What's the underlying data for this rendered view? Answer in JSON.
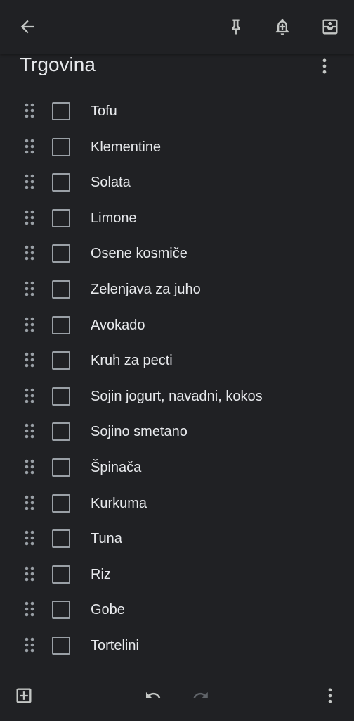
{
  "colors": {
    "background": "#202124",
    "text": "#e8eaed",
    "icon": "#c4c7c5",
    "icon_disabled": "#5f6368",
    "checkbox_border": "#9aa0a6"
  },
  "toolbar": {
    "back_icon": "arrow-back-icon",
    "pin_icon": "pin-icon",
    "reminder_icon": "add-alert-icon",
    "archive_icon": "archive-icon"
  },
  "note": {
    "title": "Trgovina",
    "more_icon": "more-vert-icon"
  },
  "checklist": {
    "items": [
      {
        "label": "Tofu",
        "checked": false
      },
      {
        "label": "Klementine",
        "checked": false
      },
      {
        "label": "Solata",
        "checked": false
      },
      {
        "label": "Limone",
        "checked": false
      },
      {
        "label": "Osene kosmiče",
        "checked": false
      },
      {
        "label": "Zelenjava za juho",
        "checked": false
      },
      {
        "label": "Avokado",
        "checked": false
      },
      {
        "label": "Kruh za pecti",
        "checked": false
      },
      {
        "label": "Sojin jogurt, navadni, kokos",
        "checked": false
      },
      {
        "label": "Sojino smetano",
        "checked": false
      },
      {
        "label": "Špinača",
        "checked": false
      },
      {
        "label": "Kurkuma",
        "checked": false
      },
      {
        "label": "Tuna",
        "checked": false
      },
      {
        "label": "Riz",
        "checked": false
      },
      {
        "label": "Gobe",
        "checked": false
      },
      {
        "label": "Tortelini",
        "checked": false
      }
    ]
  },
  "bottombar": {
    "add_icon": "add-box-icon",
    "undo_icon": "undo-icon",
    "redo_icon": "redo-icon",
    "redo_enabled": false,
    "more_icon": "more-vert-icon"
  }
}
